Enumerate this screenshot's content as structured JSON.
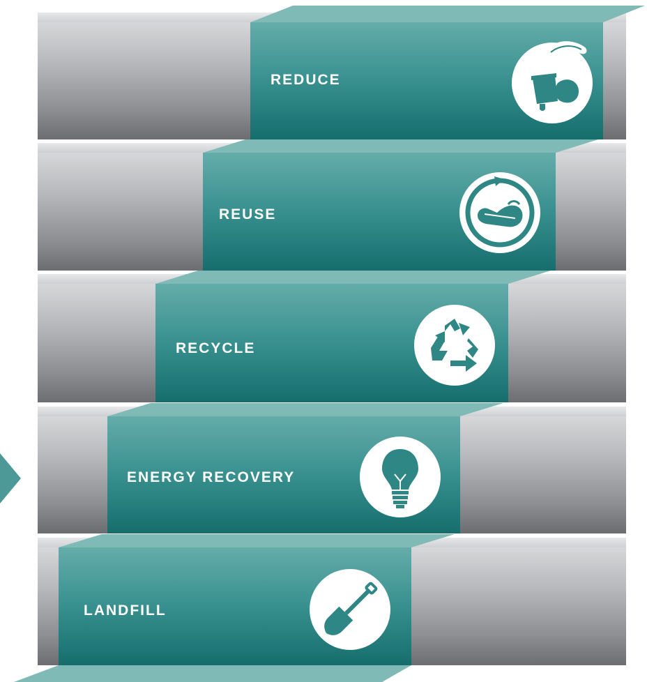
{
  "diagram": {
    "steps": [
      {
        "label": "REDUCE",
        "icon": "hand-placing-waste-bin-icon"
      },
      {
        "label": "REUSE",
        "icon": "reuse-shoe-cycle-icon"
      },
      {
        "label": "RECYCLE",
        "icon": "recycle-arrows-icon"
      },
      {
        "label": "ENERGY RECOVERY",
        "icon": "light-bulb-icon"
      },
      {
        "label": "LANDFILL",
        "icon": "shovel-icon"
      }
    ],
    "colors": {
      "teal_top": "#7fbab6",
      "teal_front_top": "#64acaa",
      "teal_front_bottom": "#166d6c",
      "gray_light": "#e0e1e3",
      "gray_dark": "#6c6d71",
      "side_arrow": "#4d9998",
      "icon_fill": "#ffffff",
      "icon_glyph": "#2f8785"
    }
  }
}
